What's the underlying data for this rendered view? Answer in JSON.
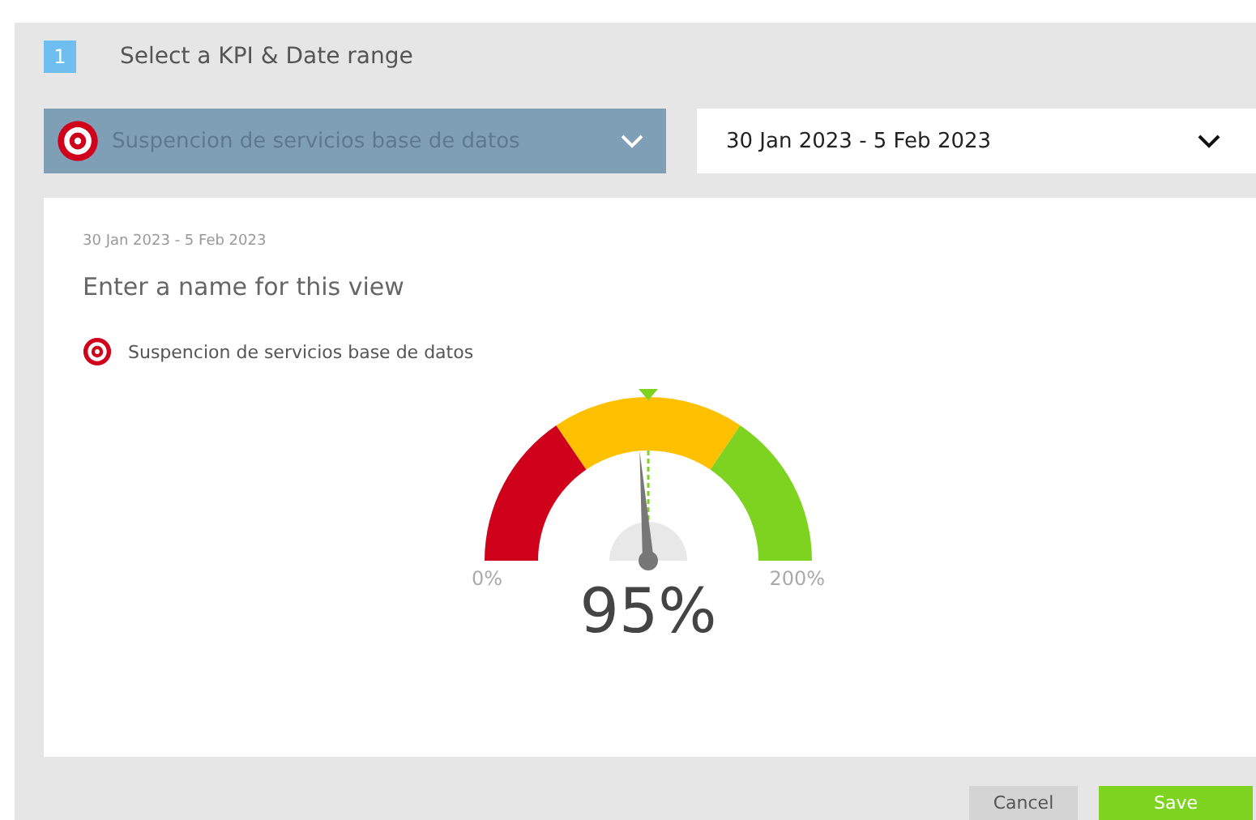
{
  "step": {
    "number": "1",
    "title": "Select a KPI & Date range"
  },
  "kpi_select": {
    "value": "Suspencion de servicios base de datos"
  },
  "date_select": {
    "value": "30 Jan 2023 - 5 Feb 2023"
  },
  "view": {
    "date_range": "30 Jan 2023 - 5 Feb 2023",
    "name_placeholder": "Enter a name for this view",
    "kpi_name": "Suspencion de servicios base de datos",
    "gauge": {
      "min_label": "0%",
      "max_label": "200%",
      "value": "95%",
      "level": 0.475
    }
  },
  "buttons": [
    {
      "label": "Cancel",
      "kind": "secondary"
    },
    {
      "label": "Save",
      "kind": "primary"
    }
  ]
}
